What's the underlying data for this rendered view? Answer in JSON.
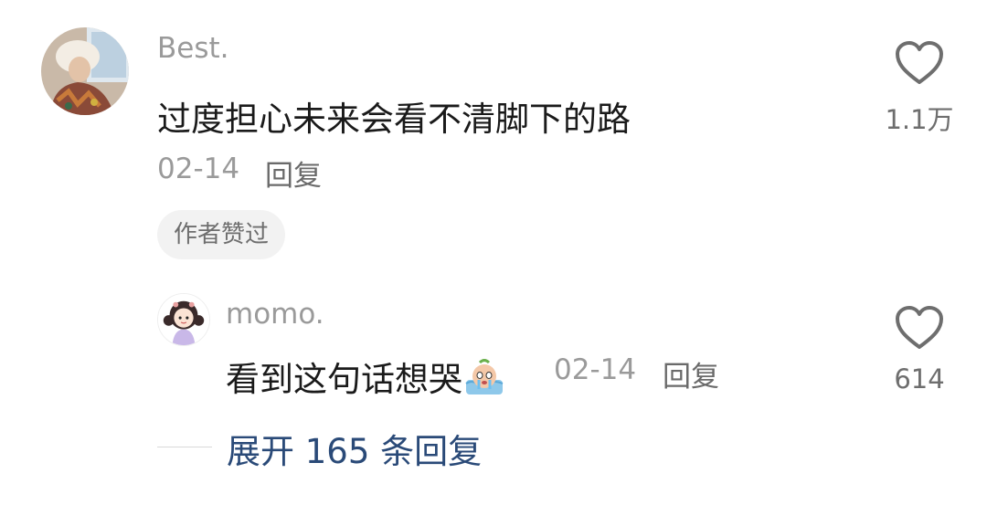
{
  "comments": [
    {
      "username": "Best.",
      "text": "过度担心未来会看不清脚下的路",
      "date": "02-14",
      "reply_label": "回复",
      "badge": "作者赞过",
      "like_count": "1.1万"
    }
  ],
  "reply": {
    "username": "momo.",
    "text": "看到这句话想哭",
    "emoji": "crying-emoji",
    "date": "02-14",
    "reply_label": "回复",
    "like_count": "614"
  },
  "expand": {
    "label": "展开 165 条回复"
  },
  "colors": {
    "username": "#9a9a9a",
    "text": "#1a1a1a",
    "link": "#2a4a78",
    "badge_bg": "#f2f2f2"
  }
}
